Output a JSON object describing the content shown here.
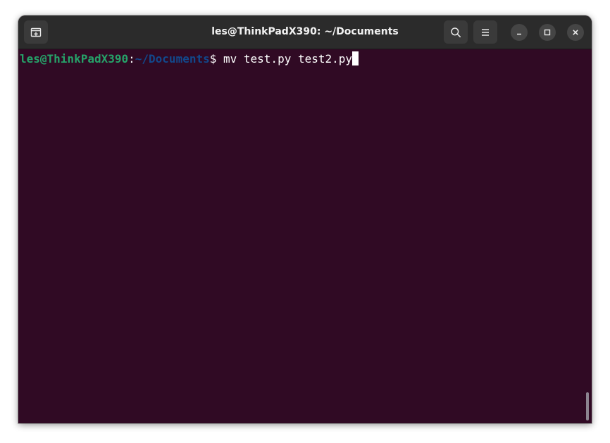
{
  "window": {
    "title": "les@ThinkPadX390: ~/Documents"
  },
  "headerbar": {
    "new_tab_icon": "new-tab-icon",
    "search_icon": "search-icon",
    "menu_icon": "hamburger-menu-icon",
    "minimize_icon": "minimize-icon",
    "maximize_icon": "maximize-icon",
    "close_icon": "close-icon"
  },
  "terminal": {
    "prompt": {
      "user_host": "les@ThinkPadX390",
      "colon": ":",
      "path": "~/Documents",
      "dollar": "$ "
    },
    "command": "mv test.py test2.py"
  },
  "colors": {
    "terminal_bg": "#300a24",
    "headerbar_bg": "#2b2b2b",
    "prompt_user": "#26a269",
    "prompt_path": "#12488b",
    "text": "#ffffff"
  }
}
